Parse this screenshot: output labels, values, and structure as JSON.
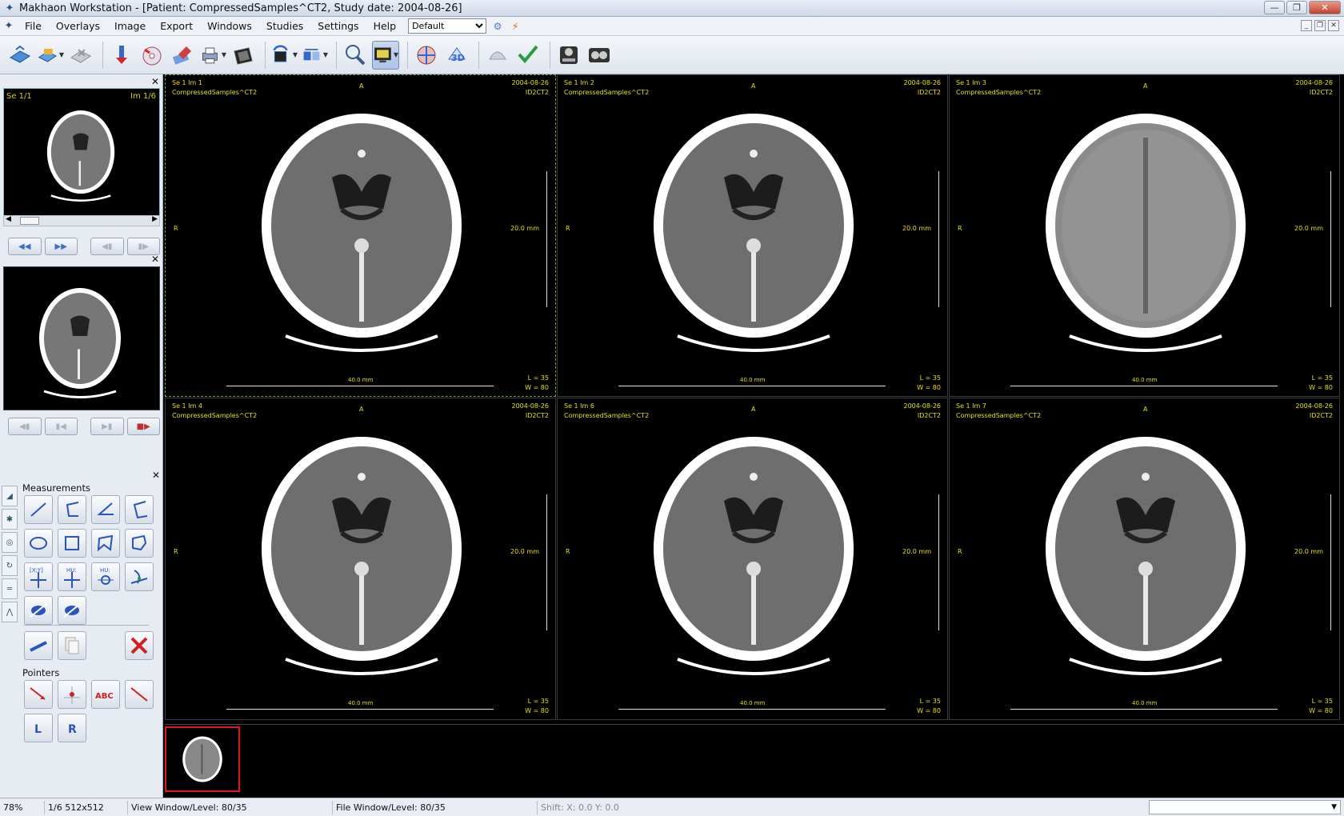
{
  "window": {
    "title": "Makhaon Workstation - [Patient: CompressedSamples^CT2, Study date: 2004-08-26]"
  },
  "menu": {
    "items": [
      "File",
      "Overlays",
      "Image",
      "Export",
      "Windows",
      "Studies",
      "Settings",
      "Help"
    ],
    "layout_select": "Default"
  },
  "series_panel": {
    "series_label": "Se 1/1",
    "image_label": "Im 1/6"
  },
  "tools_panel": {
    "measurements_label": "Measurements",
    "pointers_label": "Pointers",
    "xy_label": "[X;Y]",
    "hu_label": "HU:",
    "hu2_label": "HU:",
    "abc_label": "ABC",
    "l_label": "L",
    "r_label": "R"
  },
  "viewports": [
    {
      "id": "Se 1 Im 1",
      "date": "2004-08-26",
      "patient": "CompressedSamples^CT2",
      "pid": "ID2CT2",
      "top": "A",
      "left": "R",
      "scale": "20.0 mm",
      "bottom_scale": "40.0 mm",
      "level": "L = 35",
      "window": "W = 80"
    },
    {
      "id": "Se 1 Im 2",
      "date": "2004-08-26",
      "patient": "CompressedSamples^CT2",
      "pid": "ID2CT2",
      "top": "A",
      "left": "R",
      "scale": "20.0 mm",
      "bottom_scale": "40.0 mm",
      "level": "L = 35",
      "window": "W = 80"
    },
    {
      "id": "Se 1 Im 3",
      "date": "2004-08-26",
      "patient": "CompressedSamples^CT2",
      "pid": "ID2CT2",
      "top": "A",
      "left": "R",
      "scale": "20.0 mm",
      "bottom_scale": "40.0 mm",
      "level": "L = 35",
      "window": "W = 80"
    },
    {
      "id": "Se 1 Im 4",
      "date": "2004-08-26",
      "patient": "CompressedSamples^CT2",
      "pid": "ID2CT2",
      "top": "A",
      "left": "R",
      "scale": "20.0 mm",
      "bottom_scale": "40.0 mm",
      "level": "L = 35",
      "window": "W = 80"
    },
    {
      "id": "Se 1 Im 6",
      "date": "2004-08-26",
      "patient": "CompressedSamples^CT2",
      "pid": "ID2CT2",
      "top": "A",
      "left": "R",
      "scale": "20.0 mm",
      "bottom_scale": "40.0 mm",
      "level": "L = 35",
      "window": "W = 80"
    },
    {
      "id": "Se 1 Im 7",
      "date": "2004-08-26",
      "patient": "CompressedSamples^CT2",
      "pid": "ID2CT2",
      "top": "A",
      "left": "R",
      "scale": "20.0 mm",
      "bottom_scale": "40.0 mm",
      "level": "L = 35",
      "window": "W = 80"
    }
  ],
  "status": {
    "zoom": "78%",
    "image_info": "1/6 512x512",
    "view_wl": "View Window/Level: 80/35",
    "file_wl": "File Window/Level: 80/35",
    "shift": "Shift: X: 0.0 Y: 0.0"
  },
  "colors": {
    "overlay_text": "#e8e000",
    "active_border": "#6aa04a",
    "strip_selection": "#e01818"
  }
}
